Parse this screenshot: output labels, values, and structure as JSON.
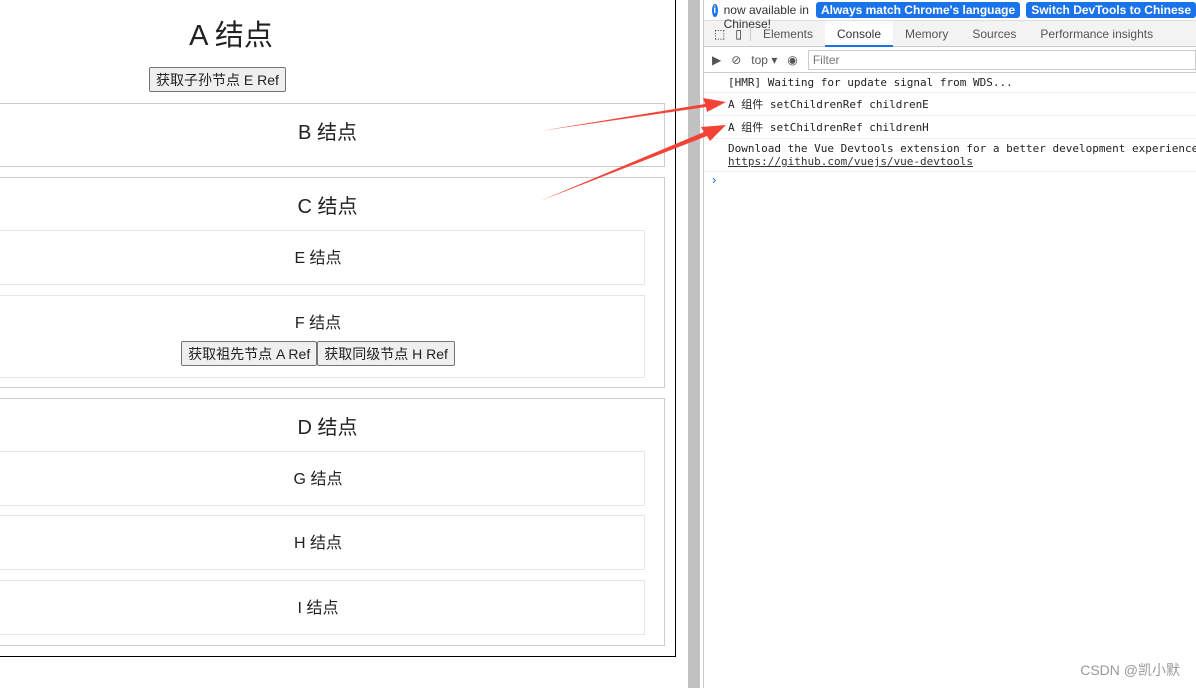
{
  "app": {
    "a_title": "A 结点",
    "a_button": "获取子孙节点 E Ref",
    "b_title": "B 结点",
    "c_title": "C 结点",
    "e_title": "E 结点",
    "f_title": "F 结点",
    "f_button_ancestor": "获取祖先节点 A Ref",
    "f_button_sibling": "获取同级节点 H Ref",
    "d_title": "D 结点",
    "g_title": "G 结点",
    "h_title": "H 结点",
    "i_title": "I 结点"
  },
  "devtools": {
    "info_text": "DevTools is now available in Chinese!",
    "info_btn1": "Always match Chrome's language",
    "info_btn2": "Switch DevTools to Chinese",
    "tabs": [
      "Elements",
      "Console",
      "Memory",
      "Sources",
      "Performance insights"
    ],
    "active_tab": "Console",
    "context": "top",
    "filter_placeholder": "Filter",
    "logs": [
      "[HMR] Waiting for update signal from WDS...",
      "A 组件 setChildrenRef childrenE",
      "A 组件 setChildrenRef childrenH",
      "Download the Vue Devtools extension for a better development experience:"
    ],
    "link": "https://github.com/vuejs/vue-devtools"
  },
  "watermark": "CSDN @凯小默",
  "colors": {
    "accent": "#1a73e8",
    "arrow": "#f44336"
  }
}
